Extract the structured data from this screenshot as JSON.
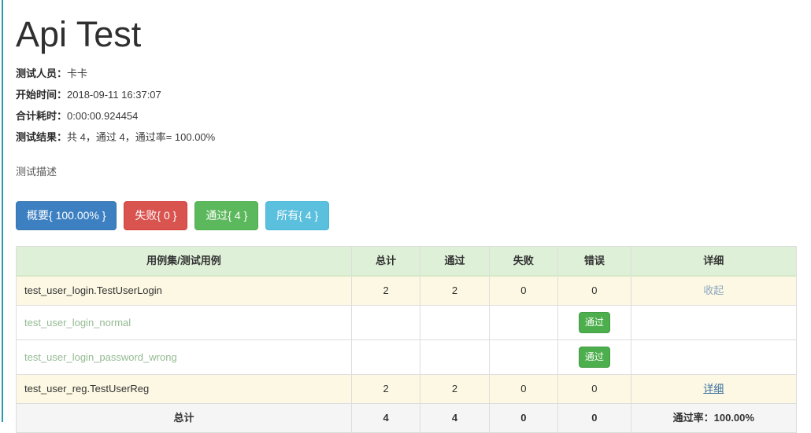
{
  "report": {
    "title": "Api Test",
    "description": "测试描述",
    "meta": [
      {
        "label": "测试人员：",
        "value": "卡卡"
      },
      {
        "label": "开始时间：",
        "value": "2018-09-11 16:37:07"
      },
      {
        "label": "合计耗时：",
        "value": "0:00:00.924454"
      },
      {
        "label": "测试结果：",
        "value": "共 4，通过 4，通过率= 100.00%"
      }
    ]
  },
  "filters": [
    {
      "label": "概要{ 100.00% }",
      "style": "btn-primary",
      "name": "summary-filter-button"
    },
    {
      "label": "失败{ 0 }",
      "style": "btn-danger",
      "name": "failed-filter-button"
    },
    {
      "label": "通过{ 4 }",
      "style": "btn-success",
      "name": "passed-filter-button"
    },
    {
      "label": "所有{ 4 }",
      "style": "btn-info",
      "name": "all-filter-button"
    }
  ],
  "table": {
    "headers": {
      "name": "用例集/测试用例",
      "total": "总计",
      "pass": "通过",
      "fail": "失败",
      "error": "错误",
      "detail": "详细"
    },
    "rows": [
      {
        "type": "suite",
        "name": "test_user_login.TestUserLogin",
        "total": "2",
        "pass": "2",
        "fail": "0",
        "error": "0",
        "detail_text": "收起",
        "detail_kind": "collapse"
      },
      {
        "type": "case",
        "name": "test_user_login_normal",
        "total": "",
        "pass": "",
        "fail": "",
        "error": "",
        "status_badge": "通过",
        "detail_text": "",
        "detail_kind": "none"
      },
      {
        "type": "case",
        "name": "test_user_login_password_wrong",
        "total": "",
        "pass": "",
        "fail": "",
        "error": "",
        "status_badge": "通过",
        "detail_text": "",
        "detail_kind": "none"
      },
      {
        "type": "suite",
        "name": "test_user_reg.TestUserReg",
        "total": "2",
        "pass": "2",
        "fail": "0",
        "error": "0",
        "detail_text": "详细",
        "detail_kind": "detail"
      }
    ],
    "total_row": {
      "label": "总计",
      "total": "4",
      "pass": "4",
      "fail": "0",
      "error": "0",
      "pass_rate": "通过率：100.00%"
    }
  },
  "colors": {
    "accent_rule": "#2a9ab0",
    "header_bg": "#dff0d8",
    "suite_row_bg": "#fcf8e3",
    "total_row_bg": "#f5f5f5",
    "badge_green": "#4cae4c",
    "primary": "#3d80c2",
    "danger": "#d9534f",
    "success": "#5cb85c",
    "info": "#5bc0de"
  }
}
